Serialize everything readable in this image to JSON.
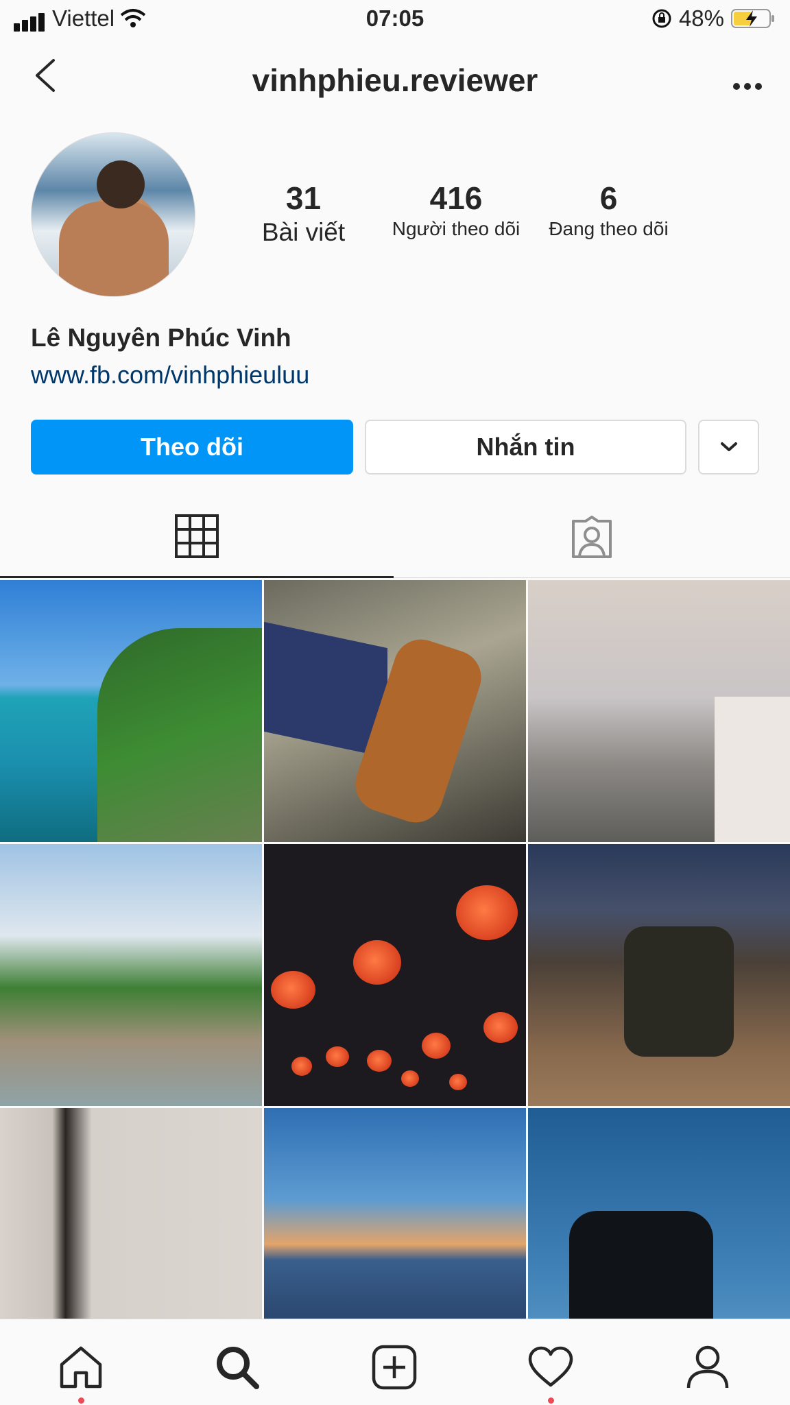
{
  "status_bar": {
    "carrier": "Viettel",
    "time": "07:05",
    "battery": "48%"
  },
  "header": {
    "username": "vinhphieu.reviewer"
  },
  "profile": {
    "name": "Lê Nguyên Phúc Vinh",
    "link": "www.fb.com/vinhphieuluu",
    "stats": [
      {
        "value": "31",
        "label": "Bài viết"
      },
      {
        "value": "416",
        "label": "Người theo dõi"
      },
      {
        "value": "6",
        "label": "Đang theo dõi"
      }
    ]
  },
  "actions": {
    "follow_label": "Theo dõi",
    "message_label": "Nhắn tin"
  },
  "tabs": [
    {
      "icon": "grid-icon"
    },
    {
      "icon": "tagged-icon"
    }
  ],
  "nav": [
    {
      "icon": "home-icon"
    },
    {
      "icon": "search-icon"
    },
    {
      "icon": "add-post-icon"
    },
    {
      "icon": "heart-icon"
    },
    {
      "icon": "profile-icon"
    }
  ],
  "colors": {
    "accent": "#0095f6",
    "link": "#00376b",
    "notification": "#ed4956"
  }
}
